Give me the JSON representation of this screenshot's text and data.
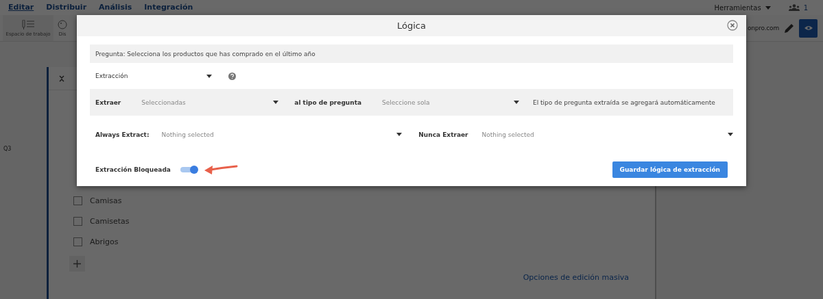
{
  "nav": {
    "tabs": [
      {
        "label": "Editar",
        "selected": true
      },
      {
        "label": "Distribuir",
        "selected": false
      },
      {
        "label": "Análisis",
        "selected": false
      },
      {
        "label": "Integración",
        "selected": false
      }
    ],
    "tools_menu": "Herramientas",
    "user_count": "1"
  },
  "toolbar": {
    "tools": [
      {
        "label": "Espacio de trabajo"
      },
      {
        "label": "Dis"
      }
    ],
    "account_text": "onpro.com"
  },
  "editor": {
    "question_number": "Q3",
    "options": [
      {
        "label": "Camisas",
        "checked": false
      },
      {
        "label": "Camisetas",
        "checked": false
      },
      {
        "label": "Abrigos",
        "checked": false
      }
    ],
    "bulk_edit_link": "Opciones de edición masiva"
  },
  "modal": {
    "title": "Lógica",
    "question": "Pregunta: Selecciona los productos que has comprado en el último año",
    "extraction_type": "Extracción",
    "extract": {
      "label": "Extraer",
      "value": "Seleccionadas",
      "type_label": "al tipo de pregunta",
      "type_value": "Seleccione sola",
      "note": "El tipo de pregunta extraída se agregará automáticamente"
    },
    "always_extract": {
      "label": "Always Extract:",
      "value": "Nothing selected"
    },
    "never_extract": {
      "label": "Nunca Extraer",
      "value": "Nothing selected"
    },
    "locked": {
      "label": "Extracción Bloqueada",
      "on": true
    },
    "save_button": "Guardar lógica de extracción"
  }
}
